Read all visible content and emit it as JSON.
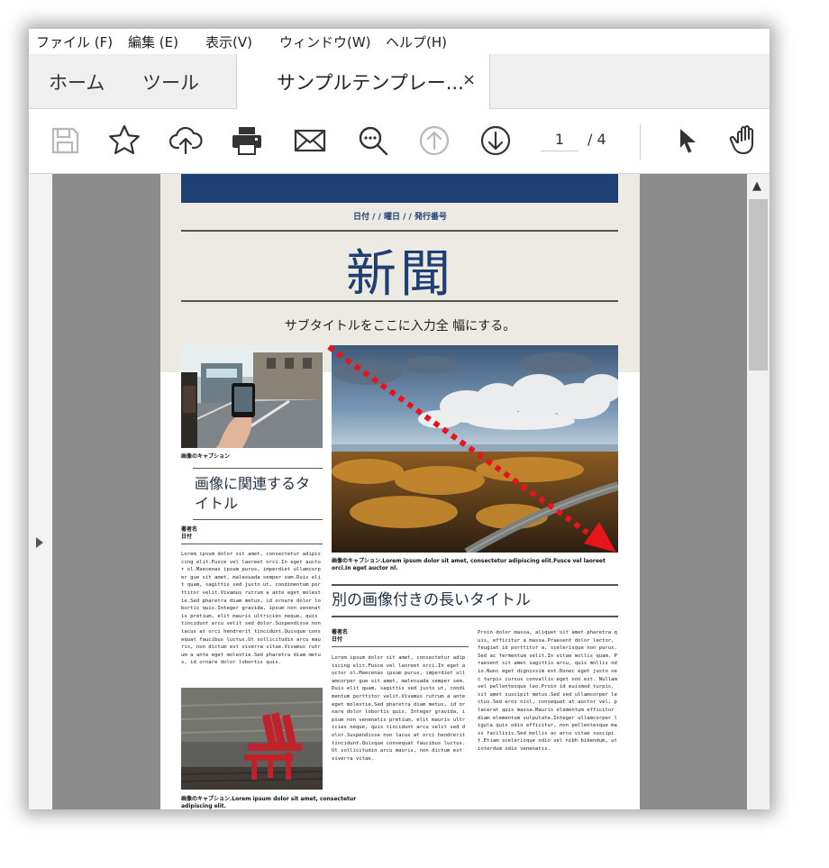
{
  "menu": [
    {
      "name": "menu-file",
      "label": "ファイル (F)"
    },
    {
      "name": "menu-edit",
      "label": "編集 (E)"
    },
    {
      "name": "menu-view",
      "label": "表示(V)"
    },
    {
      "name": "menu-window",
      "label": "ウィンドウ(W)"
    },
    {
      "name": "menu-help",
      "label": "ヘルプ(H)"
    }
  ],
  "tabs": {
    "home": "ホーム",
    "tools": "ツール",
    "document": "サンプルテンプレー...",
    "close": "×"
  },
  "toolbar": {
    "icons": [
      "save-icon",
      "star-icon",
      "cloud-upload-icon",
      "print-icon",
      "mail-icon",
      "zoom-icon",
      "page-up-icon",
      "page-down-icon",
      "select-cursor-icon",
      "hand-tool-icon"
    ],
    "current_page": "1",
    "page_separator": "/ 4",
    "total_pages": 4
  },
  "colors": {
    "accent_blue": "#1e3f73",
    "header_bg": "#eceae2",
    "arrow_red": "#e8141b",
    "viewport_gray": "#8c8c8c"
  },
  "document": {
    "date_line": "日付 / / 曜日 / / 発行番号",
    "masthead": "新聞",
    "subtitle": "サブタイトルをここに入力全 幅にする。",
    "left_caption": "画像のキャプション",
    "left_article_title": "画像に関連するタイトル",
    "left_byline": "著者名\n日付",
    "left_body": "Lorem ipsum dolor sit amet, consectetur adipiscing elit.Fusce vel laoreet orci.In eget auctor ol.Maecenas ipsum purus, imperdiet ullamcorper gue sit amet, malesuada semper sem.Duis elit quam, sagittis sed justo ut, condimentum porttitor velit.Vivamus rutrum a ante eget molestie.Sed pharetra diam metus, id ornare dolor lobortis quis.Integer gravida, ipsum non venenatis pretium, elit mauris ultricies neque, quis tincidunt arcu velit sed dolor.Suspendisse non lacus at orci hendrerit tincidunt.Quisque consequat faucibus luctus.Ut sollicitudin arcu mauris, non dictum est viverra vitae.Vivamus rutrum a ante eget molestie.Sed pharetra diam metus, id ornare dolor lobortis quis.",
    "main_caption": "画像のキャプション.Lorem ipsum dolor sit amet, consectetur adipiscing elit.Fusce vel laoreet orci.In eget auctor nl.",
    "main_article_title": "別の画像付きの長いタイトル",
    "main_byline": "著者名\n日付",
    "main_body_col1": "Lorem ipsum dolor sit amet, consectetur adipiscing elit.Fusce vel laoreet orci.In eget auctor ol.Maecenas ipsum purus, imperdiet ullamcorper gue sit amet, malesuada semper sem.Duis elit quam, sagittis sed justo ut, condimentum porttitor velit.Vivamus rutrum a ante eget molestie.Sed pharetra diam metus, id ornare dolor lobortis quis. Integer gravida, ipsum non venenatis pretium, elit mauris ultricies neque, quis tincidunt arcu velit sed dolor.Suspendisse non lacus at orci hendrerit tincidunt.Quisque consequat faucibus luctus.Ut sollicitudin arcu mauris, non dictum est viverra vitae.",
    "main_body_col2": "Proin dolor massa, aliquet sit amet pharetra quis, efficitur a massa.Praesent dolor lector, feugiat id porttitor a, scelerisque non purus.Sed ac fermentum velit.In vitae mollis quam. Praesent sit amet sagittis arcu, quis mollis odio.Nunc eget dignissim est.Donec eget justo nec turpis cursus convallis eget non est. Nullam vel pellentesque leo.Proin id euismod turpis, sit amet suscipit metus.Sed sed ullamcorper lectus.Sed eros nisl, consequat at auctor vel, placerat quis massa.Mauris elementum efficitur diam elementum vulputate.Integer ullamcorper ligula quis odio efficitur, non pellentesque mass facilisis.Sed mollis ac arcu vitae suscipit.Etiam scelerisque odio vel nibh bibendum, ut interdum odio venenatis.",
    "chair_caption": "画像のキャプション.Lorem ipsum dolor sit amet, consectetur adipiscing elit."
  }
}
